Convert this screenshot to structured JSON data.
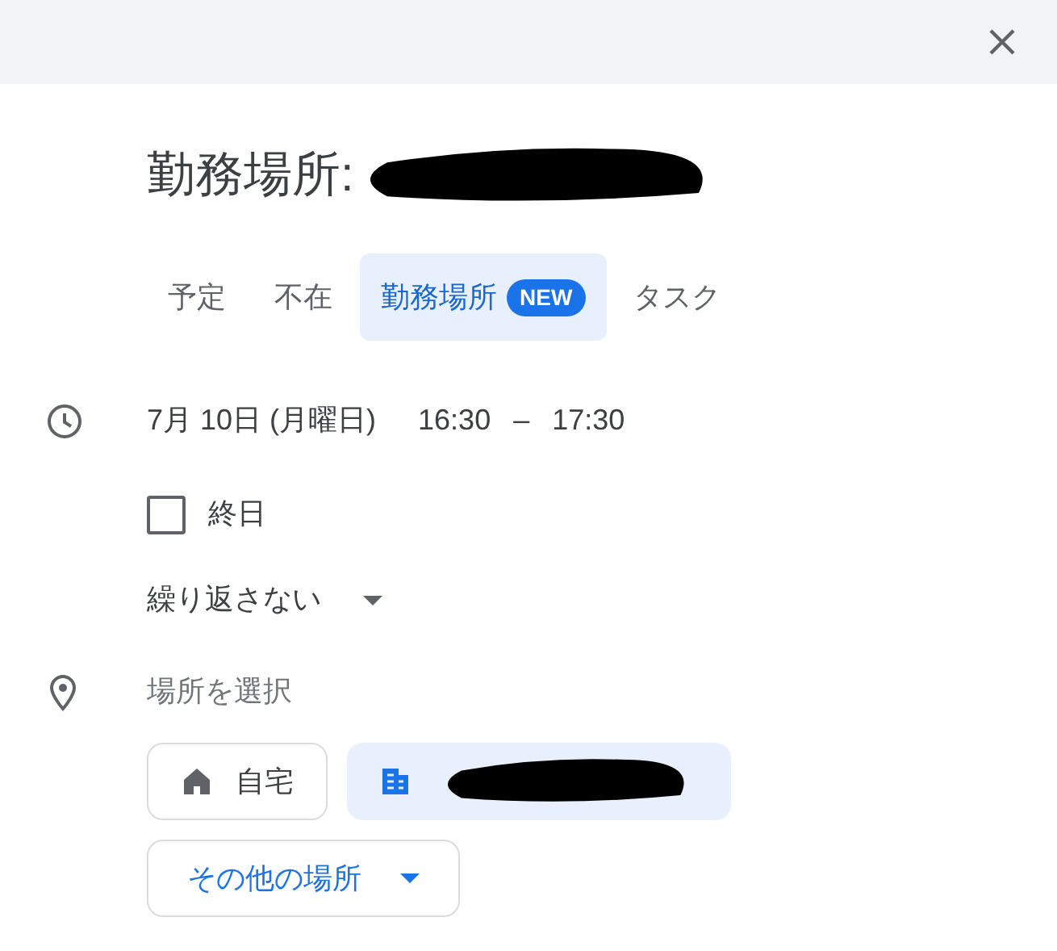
{
  "title": "勤務場所:",
  "tabs": [
    {
      "label": "予定",
      "selected": false
    },
    {
      "label": "不在",
      "selected": false
    },
    {
      "label": "勤務場所",
      "selected": true,
      "badge": "NEW"
    },
    {
      "label": "タスク",
      "selected": false
    }
  ],
  "date": "7月 10日 (月曜日)",
  "start_time": "16:30",
  "separator": "–",
  "end_time": "17:30",
  "all_day": {
    "label": "終日",
    "checked": false
  },
  "repeat": "繰り返さない",
  "location": {
    "placeholder": "場所を選択",
    "chips": [
      {
        "kind": "home",
        "label": "自宅",
        "selected": false
      },
      {
        "kind": "office",
        "selected": true
      }
    ],
    "more": "その他の場所"
  }
}
